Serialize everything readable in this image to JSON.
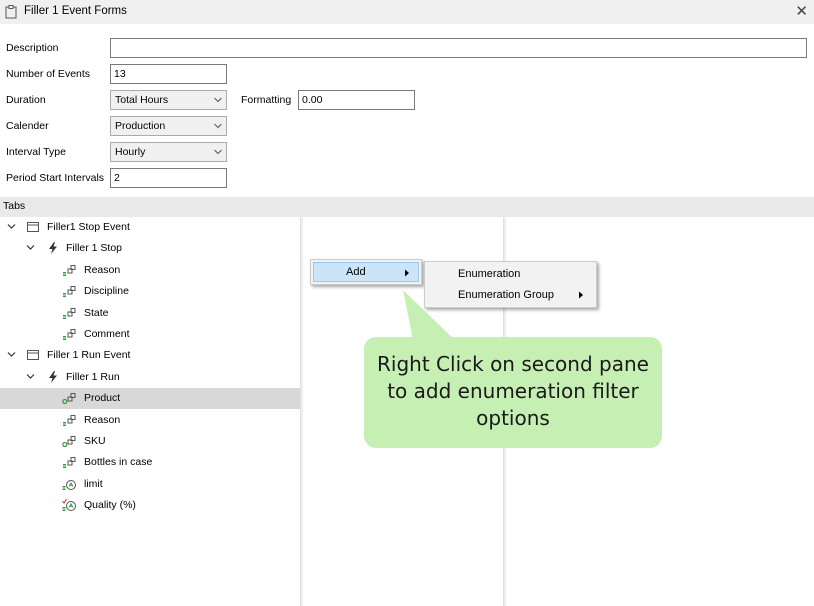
{
  "window": {
    "title": "Filler 1 Event Forms",
    "close_glyph": "✕"
  },
  "form": {
    "description": {
      "label": "Description",
      "value": ""
    },
    "number_of_events": {
      "label": "Number of Events",
      "value": "13"
    },
    "duration": {
      "label": "Duration",
      "selected": "Total Hours"
    },
    "formatting": {
      "label": "Formatting",
      "value": "0.00"
    },
    "calender": {
      "label": "Calender",
      "selected": "Production"
    },
    "interval_type": {
      "label": "Interval Type",
      "selected": "Hourly"
    },
    "period_start_intervals": {
      "label": "Period Start Intervals",
      "value": "2"
    }
  },
  "tabs": {
    "header": "Tabs",
    "tree": [
      {
        "label": "Filler1 Stop Event",
        "icon": "form-tab-icon",
        "expanded": true
      },
      {
        "label": "Filler 1 Stop",
        "icon": "lightning-event-icon",
        "expanded": true
      },
      {
        "label": "Reason",
        "icon": "field-icon"
      },
      {
        "label": "Discipline",
        "icon": "field-icon"
      },
      {
        "label": "State",
        "icon": "field-icon"
      },
      {
        "label": "Comment",
        "icon": "field-icon"
      },
      {
        "label": "Filler 1 Run Event",
        "icon": "form-tab-icon",
        "expanded": true
      },
      {
        "label": "Filler 1 Run",
        "icon": "lightning-event-icon",
        "expanded": true
      },
      {
        "label": "Product",
        "icon": "key-field-icon",
        "selected": true
      },
      {
        "label": "Reason",
        "icon": "field-icon"
      },
      {
        "label": "SKU",
        "icon": "key-field-icon"
      },
      {
        "label": "Bottles in case",
        "icon": "field-icon"
      },
      {
        "label": "limit",
        "icon": "calc-field-icon"
      },
      {
        "label": "Quality (%)",
        "icon": "calc-check-field-icon"
      }
    ]
  },
  "context_menu": {
    "add_label": "Add",
    "submenu": [
      "Enumeration",
      "Enumeration Group"
    ]
  },
  "callout": {
    "text": "Right Click on second pane to add enumeration filter options",
    "color": "#c6efb3"
  },
  "colors": {
    "selection": "#d8d8d8",
    "menu_highlight": "#cce4f7",
    "event_icon": "#333333"
  }
}
